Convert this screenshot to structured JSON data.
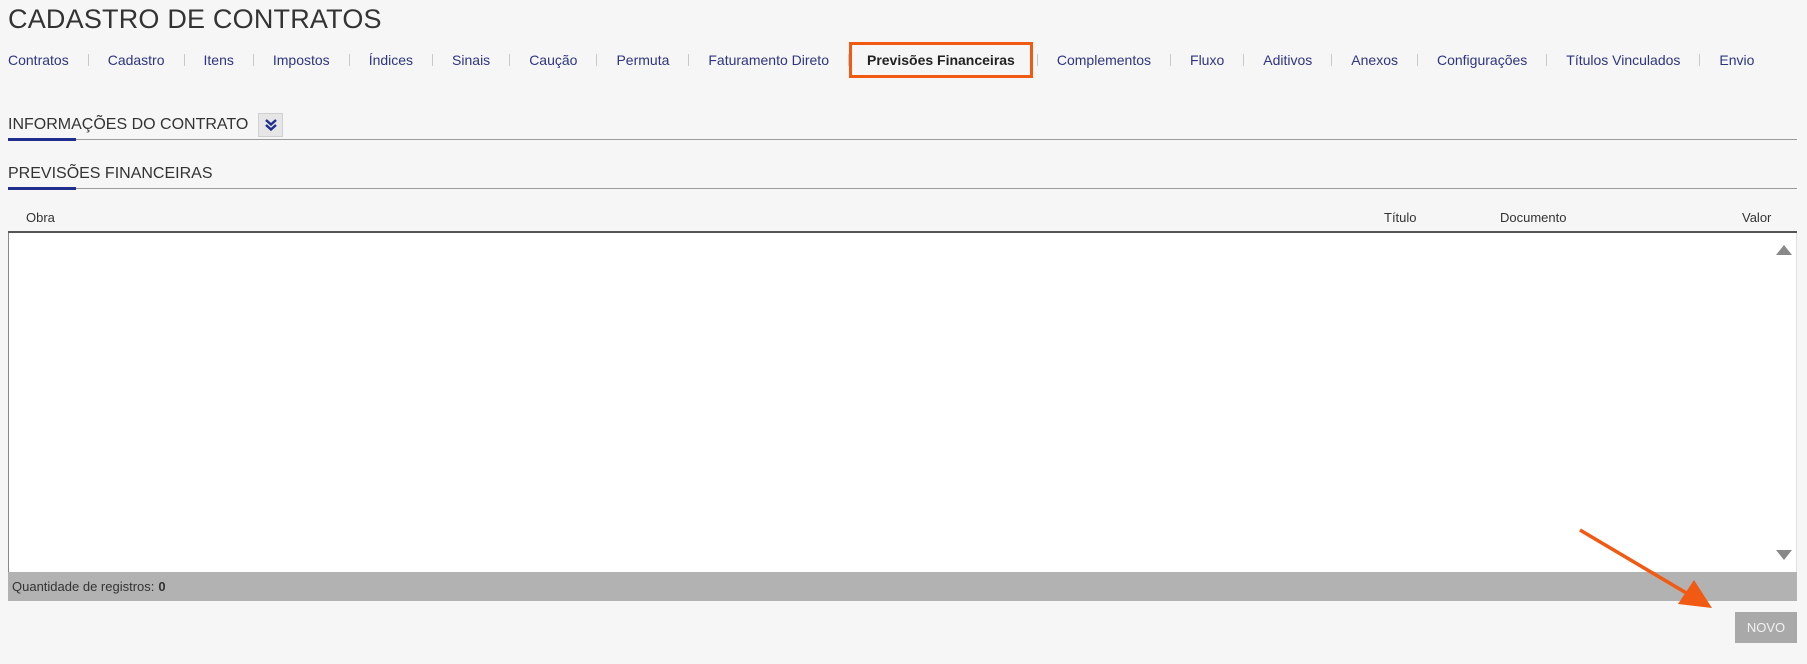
{
  "page": {
    "title": "CADASTRO DE CONTRATOS"
  },
  "tabs": [
    {
      "label": "Contratos"
    },
    {
      "label": "Cadastro"
    },
    {
      "label": "Itens"
    },
    {
      "label": "Impostos"
    },
    {
      "label": "Índices"
    },
    {
      "label": "Sinais"
    },
    {
      "label": "Caução"
    },
    {
      "label": "Permuta"
    },
    {
      "label": "Faturamento Direto"
    },
    {
      "label": "Previsões Financeiras",
      "active": true
    },
    {
      "label": "Complementos"
    },
    {
      "label": "Fluxo"
    },
    {
      "label": "Aditivos"
    },
    {
      "label": "Anexos"
    },
    {
      "label": "Configurações"
    },
    {
      "label": "Títulos Vinculados"
    },
    {
      "label": "Envio"
    }
  ],
  "sections": {
    "info": {
      "title": "INFORMAÇÕES DO CONTRATO",
      "toggle_icon": "double-chevron-down-icon"
    },
    "previsoes": {
      "title": "PREVISÕES FINANCEIRAS"
    }
  },
  "grid": {
    "columns": [
      "Obra",
      "Título",
      "Documento",
      "Valor"
    ],
    "rows": [],
    "footer": {
      "label": "Quantidade de registros:",
      "count": "0"
    }
  },
  "actions": {
    "new_label": "NOVO"
  },
  "colors": {
    "accent": "#1f2e8c",
    "highlight": "#f05a12",
    "link": "#2d3580"
  }
}
